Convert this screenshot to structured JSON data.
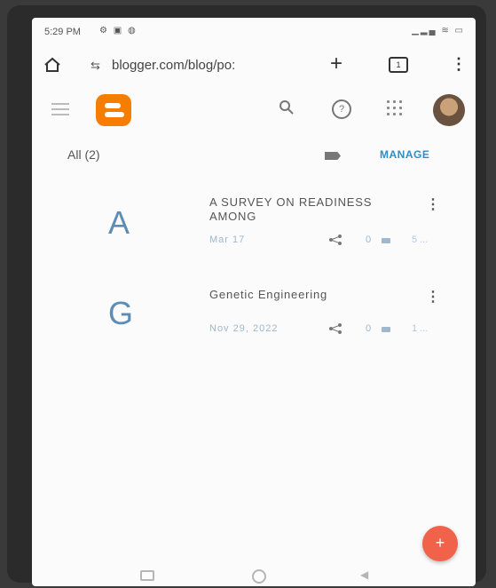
{
  "status_bar": {
    "time": "5:29 PM",
    "left_icons": "⚙ ▣ ◍",
    "right_icons": "▁▂▄ ≋ ▭"
  },
  "browser": {
    "url": "blogger.com/blog/po:",
    "site_settings_icon": "⇆",
    "new_tab_label": "+",
    "tabs_count": "1",
    "menu_label": "⋮"
  },
  "app": {
    "help_label": "?",
    "filter_label": "All (2)",
    "manage_label": "MANAGE"
  },
  "posts": [
    {
      "initial": "A",
      "title": "A SURVEY ON READINESS AMONG",
      "date": "Mar 17",
      "comments": "0",
      "views": "5 ..."
    },
    {
      "initial": "G",
      "title": "Genetic Engineering",
      "date": "Nov 29, 2022",
      "comments": "0",
      "views": "1 ..."
    }
  ],
  "fab_label": "+",
  "colors": {
    "accent": "#2c8fc8",
    "brand": "#f57d00",
    "fab": "#f0624a",
    "initial": "#5d8db5"
  },
  "icons": [
    "home-icon",
    "site-settings-icon",
    "plus-icon",
    "tabs-icon",
    "more-vert-icon",
    "hamburger-icon",
    "blogger-logo",
    "search-icon",
    "help-icon",
    "apps-icon",
    "avatar",
    "label-icon",
    "share-icon",
    "comment-icon"
  ]
}
